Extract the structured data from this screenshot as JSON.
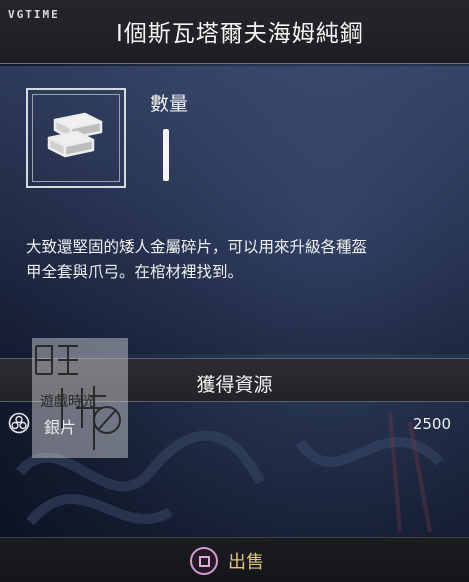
{
  "header": {
    "watermark": "VGTIME",
    "title": "I個斯瓦塔爾夫海姆純鋼"
  },
  "item": {
    "icon": "silver-ingots-icon",
    "quantity_label": "數量",
    "description_line1": "大致還堅固的矮人金屬碎片，可以用來升級各種盔",
    "description_line2": "甲全套與爪弓。在棺材裡找到。"
  },
  "resources": {
    "title": "獲得資源",
    "items": [
      {
        "icon": "hacksilver-icon",
        "name": "銀片",
        "value": "2500"
      }
    ]
  },
  "overlay": {
    "logo_text": "遊戲時光",
    "icon": "site-logo-icon"
  },
  "footer": {
    "sell_icon": "square-button-icon",
    "sell_label": "出售"
  },
  "colors": {
    "header_bg": "#222327",
    "panel_bg": "#2a3658",
    "sell_label": "#e0c27a",
    "sell_button_ring": "#d69ad3"
  }
}
